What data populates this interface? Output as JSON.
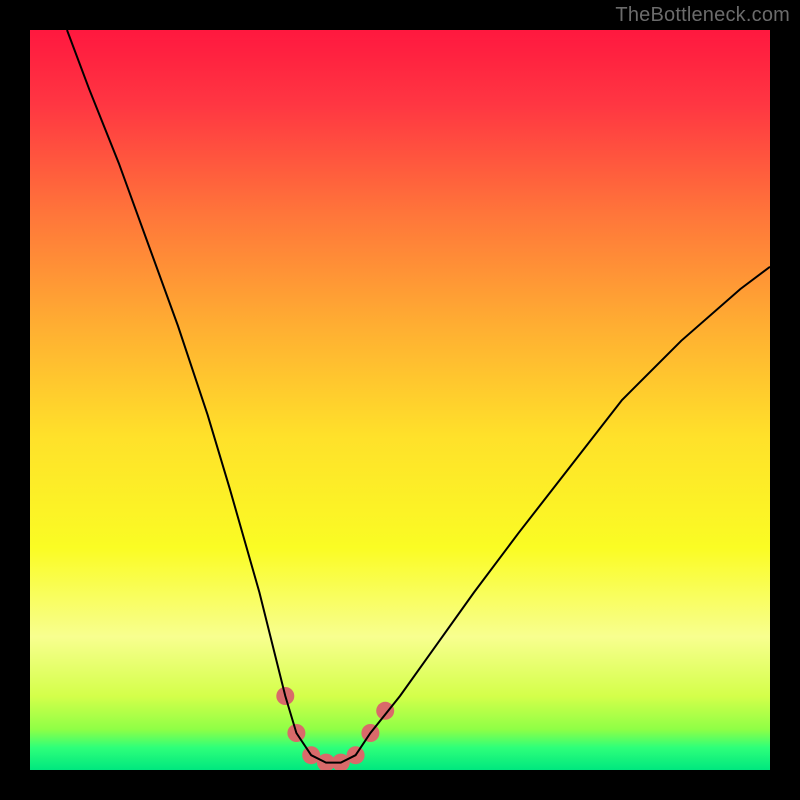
{
  "watermark": "TheBottleneck.com",
  "chart_data": {
    "type": "line",
    "title": "",
    "xlabel": "",
    "ylabel": "",
    "xlim": [
      0,
      100
    ],
    "ylim": [
      0,
      100
    ],
    "grid": false,
    "legend": false,
    "background_gradient_stops": [
      {
        "offset": 0.0,
        "color": "#ff183f"
      },
      {
        "offset": 0.1,
        "color": "#ff3642"
      },
      {
        "offset": 0.25,
        "color": "#ff763a"
      },
      {
        "offset": 0.4,
        "color": "#ffae32"
      },
      {
        "offset": 0.55,
        "color": "#ffe12a"
      },
      {
        "offset": 0.7,
        "color": "#fafc24"
      },
      {
        "offset": 0.82,
        "color": "#f8ff8f"
      },
      {
        "offset": 0.9,
        "color": "#d4ff4a"
      },
      {
        "offset": 0.945,
        "color": "#8fff46"
      },
      {
        "offset": 0.97,
        "color": "#2dff7a"
      },
      {
        "offset": 1.0,
        "color": "#00e77f"
      }
    ],
    "series": [
      {
        "name": "bottleneck-curve",
        "color": "#000000",
        "stroke_width": 2,
        "x": [
          5,
          8,
          12,
          16,
          20,
          24,
          27,
          29,
          31,
          33,
          34.5,
          36,
          38,
          40,
          42,
          44,
          46,
          50,
          55,
          60,
          66,
          73,
          80,
          88,
          96,
          100
        ],
        "y": [
          100,
          92,
          82,
          71,
          60,
          48,
          38,
          31,
          24,
          16,
          10,
          5,
          2,
          1,
          1,
          2,
          5,
          10,
          17,
          24,
          32,
          41,
          50,
          58,
          65,
          68
        ]
      }
    ],
    "markers": {
      "name": "trough-markers",
      "color": "#d96a6a",
      "radius": 9,
      "points": [
        {
          "x": 34.5,
          "y": 10
        },
        {
          "x": 36,
          "y": 5
        },
        {
          "x": 38,
          "y": 2
        },
        {
          "x": 40,
          "y": 1
        },
        {
          "x": 42,
          "y": 1
        },
        {
          "x": 44,
          "y": 2
        },
        {
          "x": 46,
          "y": 5
        },
        {
          "x": 48,
          "y": 8
        }
      ]
    }
  }
}
